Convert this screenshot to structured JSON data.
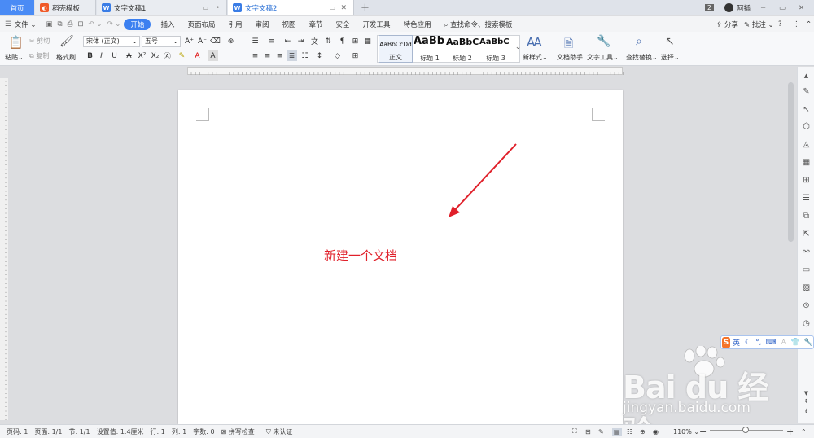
{
  "tabs": {
    "home": "首页",
    "templates": "稻壳模板",
    "doc1": "文字文稿1",
    "doc2": "文字文稿2",
    "new_tab": "+"
  },
  "window": {
    "badge": "2",
    "user": "阿插"
  },
  "menu": {
    "file": "文件",
    "items": [
      "开始",
      "插入",
      "页面布局",
      "引用",
      "审阅",
      "视图",
      "章节",
      "安全",
      "开发工具",
      "特色应用"
    ],
    "search": "查找命令、搜索模板",
    "share": "分享",
    "comment": "批注",
    "help": "?"
  },
  "ribbon": {
    "paste": "粘贴",
    "cut": "剪切",
    "copy": "复制",
    "format_painter": "格式刷",
    "font_name": "宋体 (正文)",
    "font_size": "五号",
    "styles": [
      {
        "sample": "AaBbCcDd",
        "name": "正文"
      },
      {
        "sample": "AaBb",
        "name": "标题 1"
      },
      {
        "sample": "AaBbC",
        "name": "标题 2"
      },
      {
        "sample": "AaBbC",
        "name": "标题 3"
      }
    ],
    "new_style": "新样式",
    "doc_assistant": "文档助手",
    "text_tools": "文字工具",
    "find_replace": "查找替换",
    "select": "选择"
  },
  "document": {
    "body_text": "新建一个文档"
  },
  "ime": {
    "mode": "英"
  },
  "watermark": {
    "brand": "Bai du 经验",
    "url": "jingyan.baidu.com"
  },
  "status": {
    "page_num": "页码: 1",
    "pages": "页面: 1/1",
    "section": "节: 1/1",
    "position": "设置值: 1.4厘米",
    "row": "行: 1",
    "col": "列: 1",
    "word_count": "字数: 0",
    "spell": "拼写检查",
    "cert": "未认证",
    "zoom": "110%"
  },
  "colors": {
    "accent": "#3c80f0",
    "annotation": "#e0202a"
  }
}
